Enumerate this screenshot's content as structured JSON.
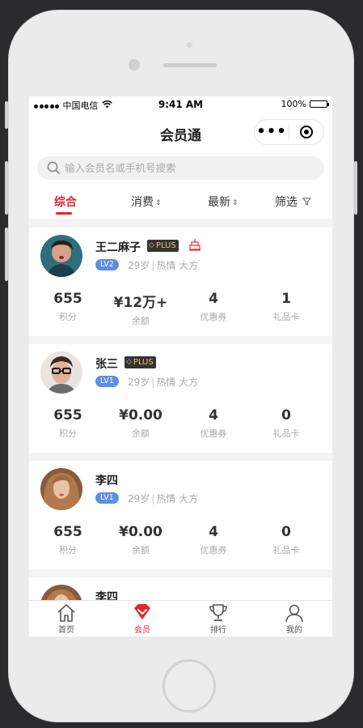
{
  "status_bar": {
    "carrier": "中国电信",
    "time": "9:41 AM",
    "battery": "100%"
  },
  "navbar": {
    "title": "会员通",
    "more_label": "•••"
  },
  "search": {
    "placeholder": "输入会员名或手机号搜索"
  },
  "filter_tabs": [
    {
      "label": "综合",
      "active": true
    },
    {
      "label": "消费",
      "sortable": true
    },
    {
      "label": "最新",
      "sortable": true
    },
    {
      "label": "筛选",
      "filter": true
    }
  ],
  "stat_labels": [
    "积分",
    "余额",
    "优惠券",
    "礼品卡"
  ],
  "members": [
    {
      "name": "王二麻子",
      "plus": "PLUS",
      "birthday_icon": true,
      "level": "LV2",
      "tags": [
        "29岁",
        "热情 大方"
      ],
      "points": "655",
      "balance": "¥12万+",
      "coupons": "4",
      "gift_cards": "1"
    },
    {
      "name": "张三",
      "plus": "PLUS",
      "level": "LV1",
      "tags": [
        "29岁",
        "热情 大方"
      ],
      "points": "655",
      "balance": "¥0.00",
      "coupons": "4",
      "gift_cards": "0"
    },
    {
      "name": "李四",
      "level": "LV1",
      "tags": [
        "29岁",
        "热情 大方"
      ],
      "points": "655",
      "balance": "¥0.00",
      "coupons": "4",
      "gift_cards": "0"
    },
    {
      "name": "李四"
    }
  ],
  "tab_bar": [
    {
      "label": "首页",
      "icon": "home-icon"
    },
    {
      "label": "会员",
      "icon": "member-heart-icon",
      "active": true
    },
    {
      "label": "排行",
      "icon": "trophy-icon"
    },
    {
      "label": "我的",
      "icon": "user-icon"
    }
  ],
  "colors": {
    "accent": "#e0262c",
    "level_badge": "#5b8fe6",
    "plus_bg": "#333333",
    "plus_text": "#e8c36a"
  }
}
